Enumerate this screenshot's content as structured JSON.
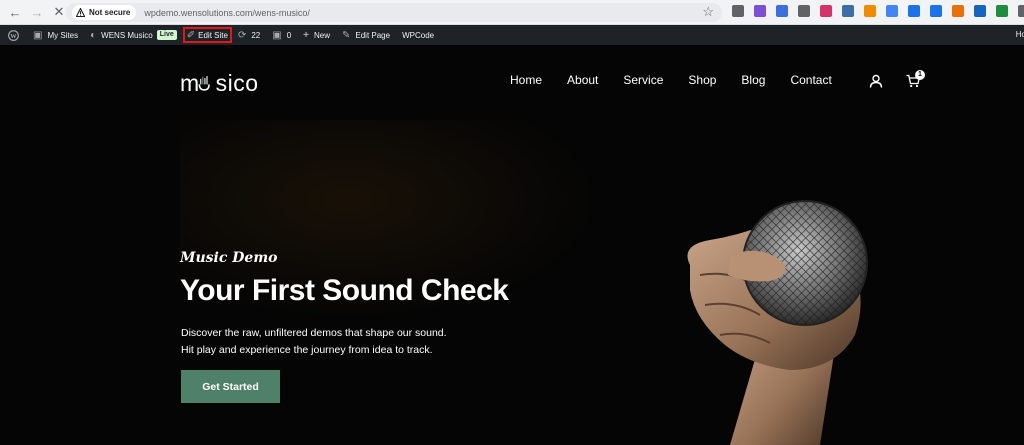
{
  "browser": {
    "security_label": "Not secure",
    "url": "wpdemo.wensolutions.com/wens-musico/",
    "extension_colors": [
      "#5f6368",
      "#7b4fd8",
      "#3b6fd9",
      "#5f6368",
      "#d6336c",
      "#3a6ea5",
      "#f08c00",
      "#4285f4",
      "#1a73e8",
      "#1a73e8",
      "#e8710a",
      "#1565c0",
      "#1e8e3e",
      "#5f6368"
    ]
  },
  "adminbar": {
    "my_sites": "My Sites",
    "site_name": "WENS Musico",
    "live_badge": "Live",
    "edit_site": "Edit Site",
    "updates_count": "22",
    "comments_count": "0",
    "new_label": "New",
    "edit_page": "Edit Page",
    "wpcode": "WPCode",
    "howdy": "Ho"
  },
  "site": {
    "logo_text": "sico",
    "menu": [
      "Home",
      "About",
      "Service",
      "Shop",
      "Blog",
      "Contact"
    ],
    "cart_count": "1"
  },
  "hero": {
    "script_title": "Music Demo",
    "headline": "Your First Sound Check",
    "desc_line1": "Discover the raw, unfiltered demos that shape our sound.",
    "desc_line2": "Hit play and experience the journey from idea to track.",
    "cta_label": "Get Started",
    "accent_color": "#4f8069"
  }
}
